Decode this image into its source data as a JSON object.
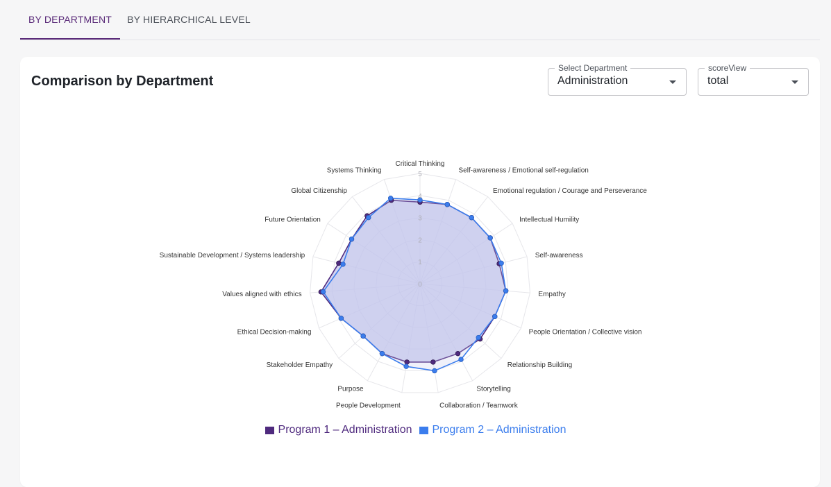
{
  "tabs": [
    {
      "label": "BY DEPARTMENT",
      "active": true
    },
    {
      "label": "BY HIERARCHICAL LEVEL",
      "active": false
    }
  ],
  "card": {
    "title": "Comparison by Department",
    "department_select": {
      "label": "Select Department",
      "value": "Administration"
    },
    "score_view_select": {
      "label": "scoreView",
      "value": "total"
    }
  },
  "colors": {
    "program1": "#4f2a7e",
    "program2": "#3b7ded",
    "fill": "#c4c6ec",
    "accent": "#5a2a79"
  },
  "chart_data": {
    "type": "radar",
    "rlim": [
      0,
      5
    ],
    "ticks": [
      0,
      1,
      2,
      3,
      4,
      5
    ],
    "axes": [
      "Critical Thinking",
      "Self-awareness / Emotional self-regulation",
      "Emotional regulation / Courage and Perseverance",
      "Intellectual Humility",
      "Self-awareness",
      "Empathy",
      "People Orientation / Collective vision",
      "Relationship Building",
      "Storytelling",
      "Collaboration / Teamwork",
      "People Development",
      "Purpose",
      "Stakeholder Empathy",
      "Ethical Decision-making",
      "Values aligned with ethics",
      "Sustainable Development / Systems leadership",
      "Future Orientation",
      "Global Citizenship",
      "Systems Thinking"
    ],
    "series": [
      {
        "name": "Program 1 – Administration",
        "values": [
          3.7,
          3.8,
          3.8,
          3.8,
          3.7,
          3.9,
          3.7,
          3.7,
          3.6,
          3.6,
          3.6,
          3.6,
          3.5,
          3.9,
          4.5,
          3.8,
          3.7,
          3.9,
          4.0
        ]
      },
      {
        "name": "Program 2 – Administration",
        "values": [
          3.8,
          3.8,
          3.8,
          3.8,
          3.8,
          3.9,
          3.7,
          3.6,
          3.9,
          4.0,
          3.8,
          3.6,
          3.5,
          3.9,
          4.4,
          3.6,
          3.7,
          3.8,
          4.1
        ]
      }
    ],
    "legend_position": "bottom"
  }
}
